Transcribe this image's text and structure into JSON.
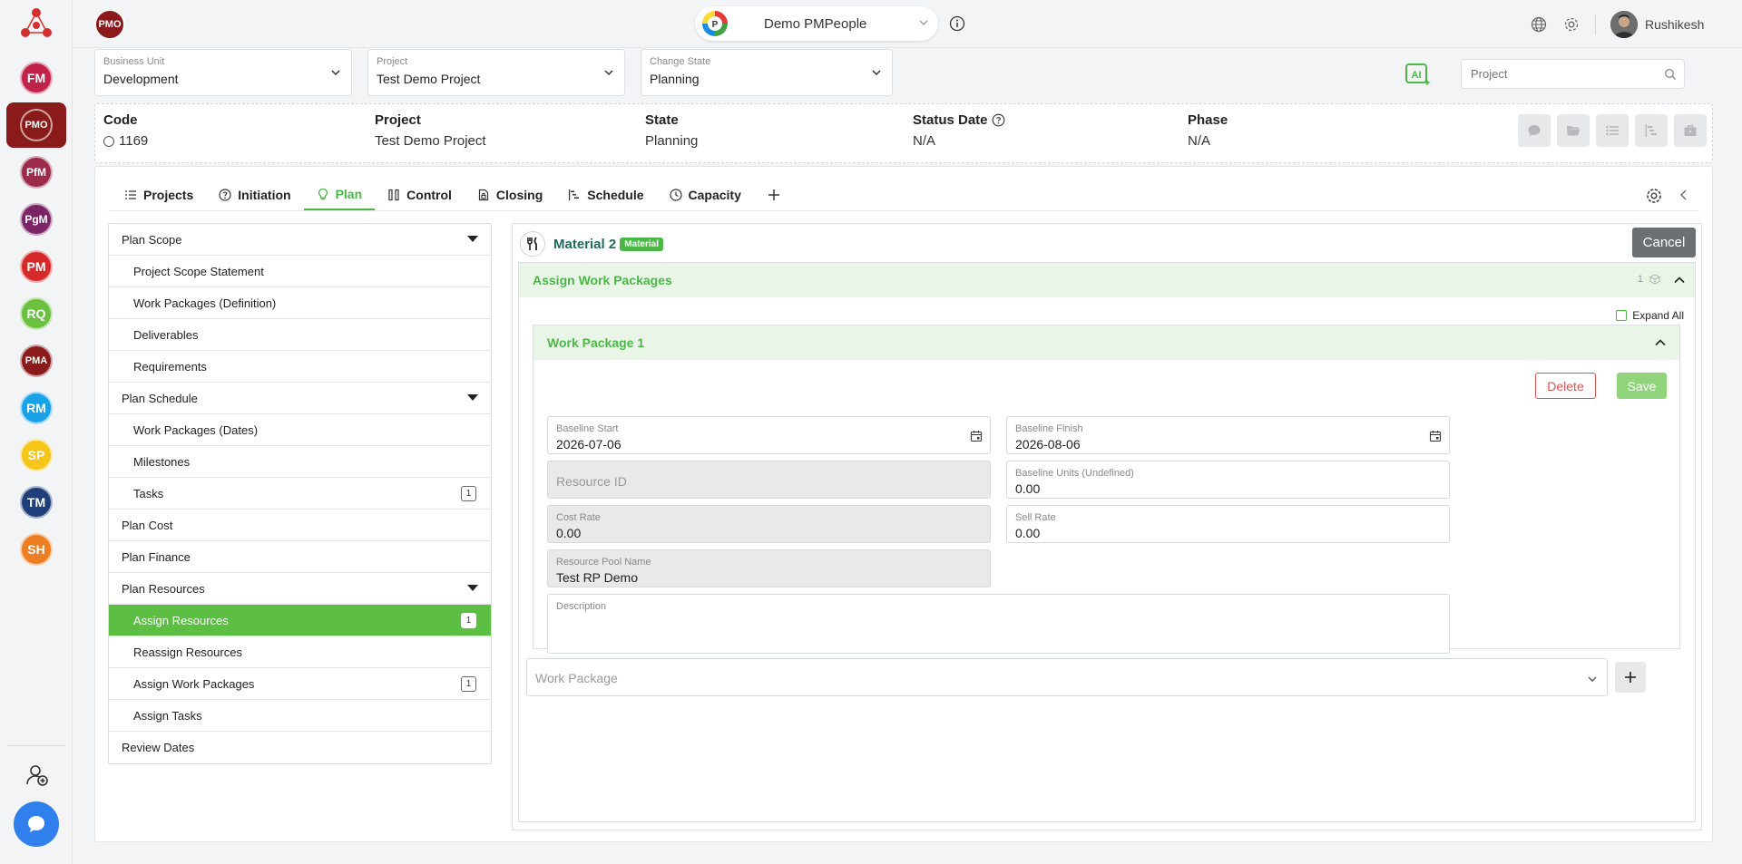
{
  "rail": {
    "items": [
      {
        "abbr": "FM",
        "color": "#c0224a"
      },
      {
        "abbr": "PMO",
        "color": "#8b1a1a"
      },
      {
        "abbr": "PfM",
        "color": "#9c2b4b"
      },
      {
        "abbr": "PgM",
        "color": "#7b2566"
      },
      {
        "abbr": "PM",
        "color": "#d62a2a"
      },
      {
        "abbr": "RQ",
        "color": "#6ac13f"
      },
      {
        "abbr": "PMA",
        "color": "#8b1a1a"
      },
      {
        "abbr": "RM",
        "color": "#1aa2e8"
      },
      {
        "abbr": "SP",
        "color": "#f5c518"
      },
      {
        "abbr": "TM",
        "color": "#1f3f7a"
      },
      {
        "abbr": "SH",
        "color": "#ef7d22"
      }
    ]
  },
  "topbar": {
    "badge": "PMO",
    "org_name": "Demo PMPeople",
    "user_name": "Rushikesh"
  },
  "filters": {
    "business_unit": {
      "label": "Business Unit",
      "value": "Development"
    },
    "project": {
      "label": "Project",
      "value": "Test Demo Project"
    },
    "change_state": {
      "label": "Change State",
      "value": "Planning"
    },
    "search_placeholder": "Project"
  },
  "info": {
    "code": {
      "label": "Code",
      "value": "1169"
    },
    "project": {
      "label": "Project",
      "value": "Test Demo Project"
    },
    "state": {
      "label": "State",
      "value": "Planning"
    },
    "status_date": {
      "label": "Status Date",
      "value": "N/A"
    },
    "phase": {
      "label": "Phase",
      "value": "N/A"
    }
  },
  "tabs": [
    {
      "label": "Projects"
    },
    {
      "label": "Initiation"
    },
    {
      "label": "Plan"
    },
    {
      "label": "Control"
    },
    {
      "label": "Closing"
    },
    {
      "label": "Schedule"
    },
    {
      "label": "Capacity"
    }
  ],
  "tree": {
    "plan_scope": "Plan Scope",
    "project_scope_statement": "Project Scope Statement",
    "work_packages_definition": "Work Packages (Definition)",
    "deliverables": "Deliverables",
    "requirements": "Requirements",
    "plan_schedule": "Plan Schedule",
    "work_packages_dates": "Work Packages (Dates)",
    "milestones": "Milestones",
    "tasks": "Tasks",
    "tasks_count": "1",
    "plan_cost": "Plan Cost",
    "plan_finance": "Plan Finance",
    "plan_resources": "Plan Resources",
    "assign_resources": "Assign Resources",
    "assign_resources_count": "1",
    "reassign_resources": "Reassign Resources",
    "assign_work_packages": "Assign Work Packages",
    "assign_work_packages_count": "1",
    "assign_tasks": "Assign Tasks",
    "review_dates": "Review Dates"
  },
  "detail": {
    "resource_name": "Material 2",
    "resource_type": "Material",
    "cancel_label": "Cancel",
    "section_title": "Assign Work Packages",
    "section_count": "1",
    "expand_all": "Expand All",
    "work_package_title": "Work Package 1",
    "delete_label": "Delete",
    "save_label": "Save",
    "fields": {
      "baseline_start": {
        "label": "Baseline Start",
        "value": "2026-07-06"
      },
      "baseline_finish": {
        "label": "Baseline Finish",
        "value": "2026-08-06"
      },
      "resource_id": {
        "placeholder": "Resource ID"
      },
      "baseline_units": {
        "label": "Baseline Units (Undefined)",
        "value": "0.00"
      },
      "cost_rate": {
        "label": "Cost Rate",
        "value": "0.00"
      },
      "sell_rate": {
        "label": "Sell Rate",
        "value": "0.00"
      },
      "resource_pool_name": {
        "label": "Resource Pool Name",
        "value": "Test RP Demo"
      },
      "description": {
        "label": "Description"
      }
    },
    "work_package_select_placeholder": "Work Package"
  }
}
